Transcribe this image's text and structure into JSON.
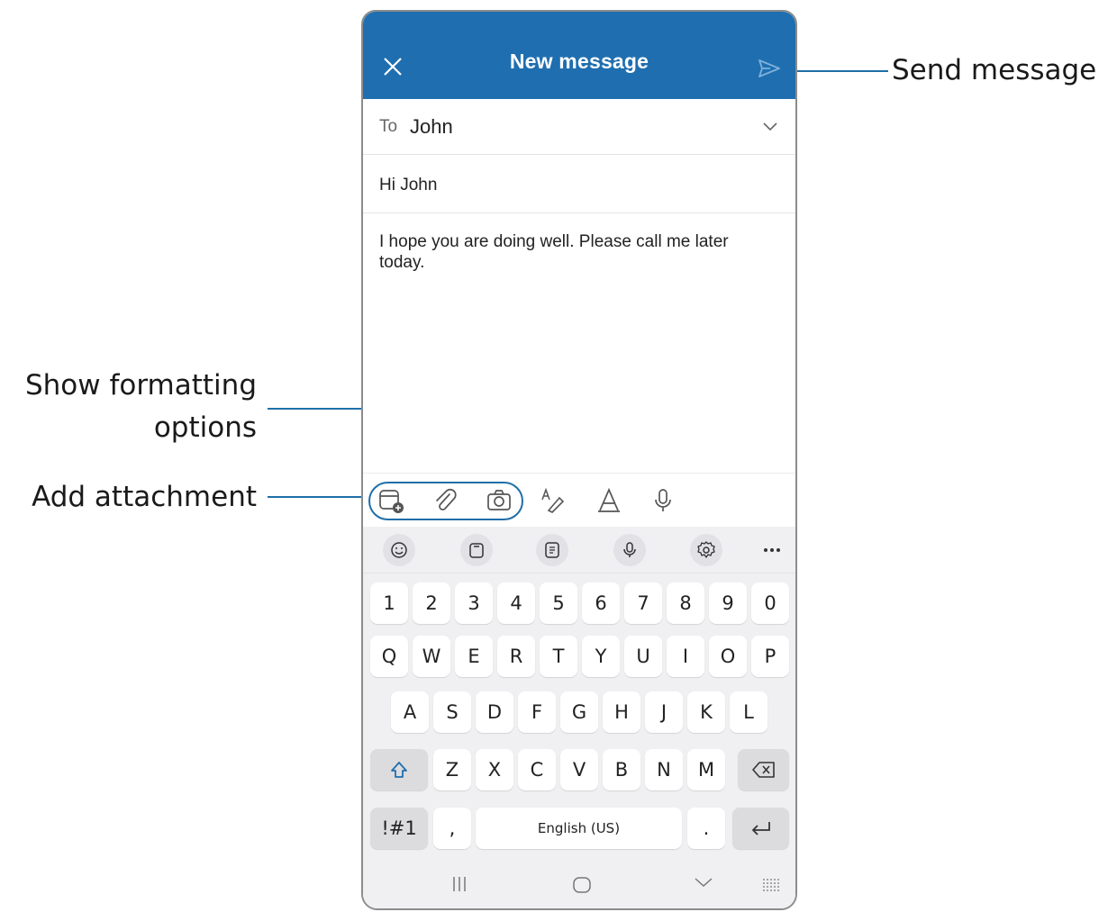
{
  "callouts": {
    "send": "Send message",
    "formatting_line1": "Show formatting",
    "formatting_line2": "options",
    "attachment": "Add attachment"
  },
  "header": {
    "title": "New message",
    "color": "#1f6fb0"
  },
  "compose": {
    "to_label": "To",
    "to_value": "John",
    "subject": "Hi John",
    "body": "I hope you are doing well. Please call me later today."
  },
  "toolbar": {
    "icons": [
      "add-file-icon",
      "paperclip-icon",
      "camera-icon",
      "format-text-icon",
      "draw-icon",
      "microphone-icon"
    ]
  },
  "keyboard": {
    "top_icons": [
      "emoji-icon",
      "clipboard-icon",
      "keyboard-mode-icon",
      "voice-input-icon",
      "settings-icon",
      "more-icon"
    ],
    "row_numbers": [
      "1",
      "2",
      "3",
      "4",
      "5",
      "6",
      "7",
      "8",
      "9",
      "0"
    ],
    "row_top": [
      "Q",
      "W",
      "E",
      "R",
      "T",
      "Y",
      "U",
      "I",
      "O",
      "P"
    ],
    "row_middle": [
      "A",
      "S",
      "D",
      "F",
      "G",
      "H",
      "J",
      "K",
      "L"
    ],
    "row_bottom": [
      "Z",
      "X",
      "C",
      "V",
      "B",
      "N",
      "M"
    ],
    "symbols_key": "!#1",
    "comma_key": ",",
    "space_label": "English (US)",
    "period_key": "."
  }
}
